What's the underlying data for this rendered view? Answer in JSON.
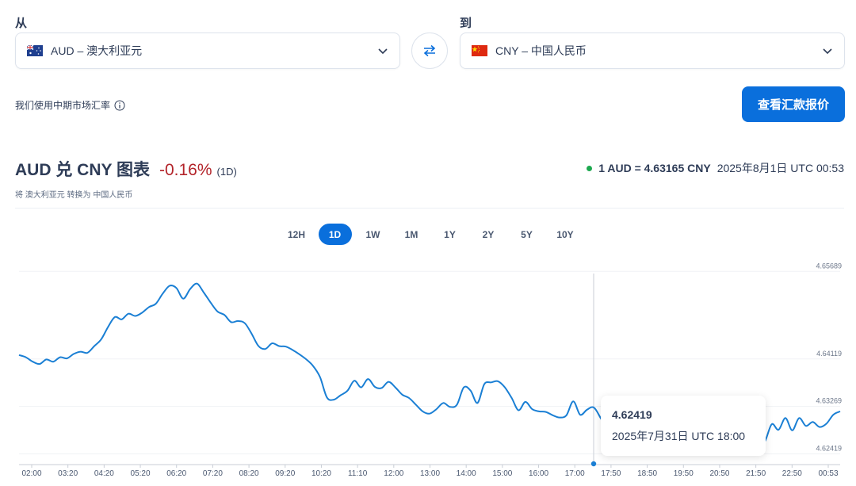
{
  "converter": {
    "from_label": "从",
    "to_label": "到",
    "from_currency": "AUD – 澳大利亚元",
    "to_currency": "CNY – 中国人民币",
    "from_flag": "australia-flag-icon",
    "to_flag": "china-flag-icon",
    "swap_icon": "swap-arrows-icon"
  },
  "note": "我们使用中期市场汇率",
  "cta_label": "查看汇款报价",
  "header": {
    "title": "AUD 兑 CNY 图表",
    "change": "-0.16%",
    "period": "(1D)",
    "subtitle": "将 澳大利亚元 转换为 中国人民币",
    "rate": "1 AUD = 4.63165 CNY",
    "rate_time": "2025年8月1日 UTC 00:53"
  },
  "tabs": [
    "12H",
    "1D",
    "1W",
    "1M",
    "1Y",
    "2Y",
    "5Y",
    "10Y"
  ],
  "active_tab": "1D",
  "tooltip": {
    "value": "4.62419",
    "time": "2025年7月31日 UTC 18:00"
  },
  "colors": {
    "line": "#1a7fd4",
    "accent": "#0a6fdc",
    "negative": "#b3242a",
    "live_dot": "#1da84f"
  },
  "chart_data": {
    "type": "line",
    "title": "AUD 兑 CNY 图表",
    "x_ticks": [
      "02:00",
      "03:20",
      "04:20",
      "05:20",
      "06:20",
      "07:20",
      "08:20",
      "09:20",
      "10:20",
      "11:10",
      "12:00",
      "13:00",
      "14:00",
      "15:00",
      "16:00",
      "17:00",
      "17:50",
      "18:50",
      "19:50",
      "20:50",
      "21:50",
      "22:50",
      "00:53"
    ],
    "y_ticks": [
      4.65689,
      4.64119,
      4.63269,
      4.62419
    ],
    "ylim": [
      4.6234,
      4.6575
    ],
    "series": [
      {
        "values": [
          4.6419,
          4.6415,
          4.6407,
          4.6403,
          4.6411,
          4.6407,
          4.6415,
          4.6413,
          4.6421,
          4.6425,
          4.6423,
          4.6435,
          4.6447,
          4.6469,
          4.6487,
          4.6483,
          4.6493,
          4.6489,
          4.6495,
          4.6505,
          4.6511,
          4.6529,
          4.6543,
          4.6539,
          4.652,
          4.6537,
          4.6547,
          4.6531,
          4.6513,
          4.6497,
          4.6491,
          4.6478,
          4.648,
          4.6476,
          4.6457,
          4.6435,
          4.643,
          4.644,
          4.6435,
          4.6434,
          4.6428,
          4.642,
          4.6411,
          4.6399,
          4.6379,
          4.6343,
          4.6339,
          4.6347,
          4.6355,
          4.6373,
          4.6361,
          4.6376,
          4.6362,
          4.636,
          4.6371,
          4.6361,
          4.6348,
          4.6342,
          4.633,
          4.6318,
          4.6314,
          4.6322,
          4.6333,
          4.6326,
          4.633,
          4.6361,
          4.6355,
          4.6333,
          4.6367,
          4.637,
          4.6372,
          4.6361,
          4.6342,
          4.632,
          4.6335,
          4.6322,
          4.6318,
          4.6317,
          4.6311,
          4.6307,
          4.6311,
          4.6336,
          4.6312,
          4.6321,
          4.6325,
          4.6306,
          4.6284,
          4.6261,
          4.6242,
          4.6245,
          4.6252,
          4.6253,
          4.6258,
          4.6252,
          4.6254,
          4.6255,
          4.6256,
          4.6258,
          4.6256,
          4.6259,
          4.6258,
          4.6262,
          4.6259,
          4.6254,
          4.6262,
          4.625,
          4.6246,
          4.6244,
          4.6257,
          4.6264,
          4.6295,
          4.6285,
          4.6306,
          4.6284,
          4.6306,
          4.6292,
          4.6299,
          4.629,
          4.6296,
          4.6312,
          4.6318
        ]
      }
    ]
  }
}
